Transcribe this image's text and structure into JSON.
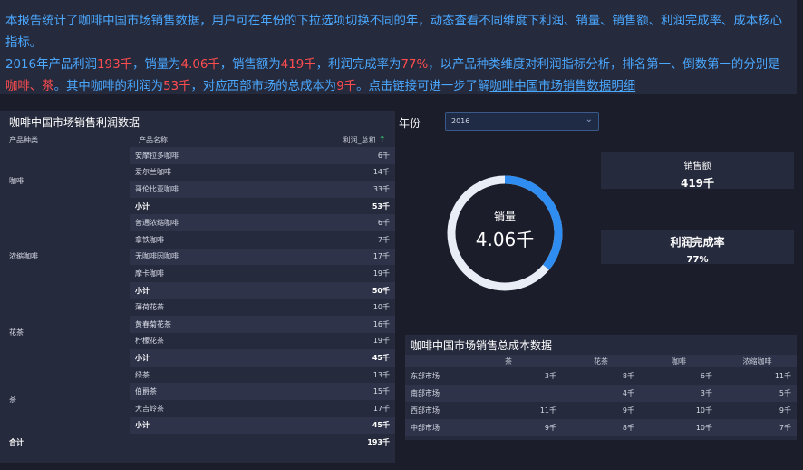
{
  "summary": {
    "line1": "本报告统计了咖啡中国市场销售数据，用户可在年份的下拉选项切换不同的年，动态查看不同维度下利润、销量、销售额、利润完成率、成本核心指标。",
    "p1": "2016年产品利润",
    "profit": "193千",
    "p2": "，销量为",
    "sales_qty": "4.06千",
    "p3": "，销售额为",
    "revenue": "419千",
    "p4": "，利润完成率为",
    "completion": "77%",
    "p5": "，以产品种类维度对利润指标分析，排名第一、倒数第一的分别是",
    "top": "咖啡",
    "p6": "、",
    "bottom": "茶",
    "p7": "。其中咖啡的利润为",
    "coffee_profit": "53千",
    "p8": "，对应西部市场的总成本为",
    "west_cost": "9千",
    "p9": "。点击链接可进一步了解",
    "link": "咖啡中国市场销售数据明细"
  },
  "profit_table": {
    "title": "咖啡中国市场销售利润数据",
    "headers": [
      "产品种类",
      "产品名称",
      "利润_总和"
    ],
    "groups": [
      {
        "category": "咖啡",
        "rows": [
          [
            "安摩拉多咖啡",
            "6千"
          ],
          [
            "爱尔兰咖啡",
            "14千"
          ],
          [
            "哥伦比亚咖啡",
            "33千"
          ]
        ],
        "subtotal": "53千"
      },
      {
        "category": "浓缩咖啡",
        "rows": [
          [
            "普通浓缩咖啡",
            "6千"
          ],
          [
            "拿铁咖啡",
            "7千"
          ],
          [
            "无咖啡因咖啡",
            "17千"
          ],
          [
            "摩卡咖啡",
            "19千"
          ]
        ],
        "subtotal": "50千"
      },
      {
        "category": "花茶",
        "rows": [
          [
            "薄荷花茶",
            "10千"
          ],
          [
            "黄春菊花茶",
            "16千"
          ],
          [
            "柠檬花茶",
            "19千"
          ]
        ],
        "subtotal": "45千"
      },
      {
        "category": "茶",
        "rows": [
          [
            "绿茶",
            "13千"
          ],
          [
            "伯爵茶",
            "15千"
          ],
          [
            "大吉岭茶",
            "17千"
          ]
        ],
        "subtotal": "45千"
      }
    ],
    "subtotal_label": "小计",
    "total_label": "合计",
    "total": "193千"
  },
  "year_filter": {
    "label": "年份",
    "value": "2016"
  },
  "donut": {
    "label": "销量",
    "value": "4.06千",
    "fill_fraction": 0.36
  },
  "kpi_revenue": {
    "label": "销售额",
    "value": "419千"
  },
  "kpi_completion": {
    "label": "利润完成率",
    "value": "77%"
  },
  "cost_table": {
    "title": "咖啡中国市场销售总成本数据",
    "headers": [
      "",
      "茶",
      "花茶",
      "咖啡",
      "浓缩咖啡"
    ],
    "rows": [
      [
        "东部市场",
        "3千",
        "8千",
        "6千",
        "11千"
      ],
      [
        "南部市场",
        "",
        "4千",
        "3千",
        "5千"
      ],
      [
        "西部市场",
        "11千",
        "9千",
        "10千",
        "9千"
      ],
      [
        "中部市场",
        "9千",
        "8千",
        "10千",
        "7千"
      ]
    ]
  },
  "colors": {
    "accent": "#4aa8ff",
    "highlight": "#ff4d4f",
    "background": "#1b1d2b",
    "panel": "#262a3d"
  }
}
